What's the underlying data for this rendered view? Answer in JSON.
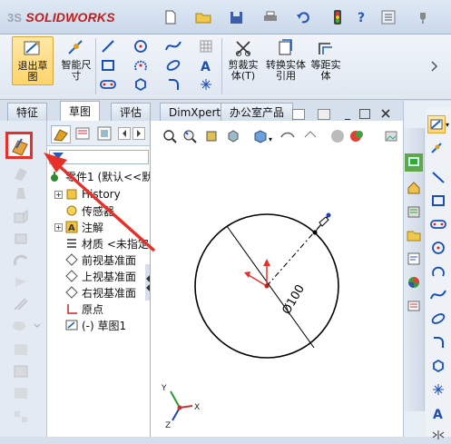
{
  "app": {
    "brand_ds": "3S",
    "brand_name": "SOLIDWORKS"
  },
  "ribbon": {
    "exit_sketch_label": "退出草图",
    "smart_dim_label": "智能尺寸",
    "trim_label": "剪裁实体(T)",
    "convert_label": "转换实体引用",
    "offset_label": "等距实体"
  },
  "tabs": [
    "特征",
    "草图",
    "评估",
    "DimXpert",
    "办公室产品"
  ],
  "active_tab": "草图",
  "tree": {
    "filter_icon": "filter-icon",
    "root": "零件1 (默认<<默",
    "items": [
      {
        "label": "History",
        "icon": "history-icon",
        "expandable": true
      },
      {
        "label": "传感器",
        "icon": "sensor-icon",
        "expandable": false
      },
      {
        "label": "注解",
        "icon": "annotation-icon",
        "expandable": true
      },
      {
        "label": "材质 <未指定>",
        "icon": "material-icon",
        "expandable": false
      },
      {
        "label": "前视基准面",
        "icon": "plane-icon",
        "expandable": false
      },
      {
        "label": "上视基准面",
        "icon": "plane-icon",
        "expandable": false
      },
      {
        "label": "右视基准面",
        "icon": "plane-icon",
        "expandable": false
      },
      {
        "label": "原点",
        "icon": "origin-icon",
        "expandable": false
      },
      {
        "label": "(-) 草图1",
        "icon": "sketch-icon",
        "expandable": false
      }
    ]
  },
  "viewport": {
    "dimension_label": "Ø100",
    "triad": [
      "Y",
      "X",
      "Z"
    ]
  },
  "colors": {
    "highlight_red": "#e8302a",
    "tree_select": "#ffe17a"
  }
}
